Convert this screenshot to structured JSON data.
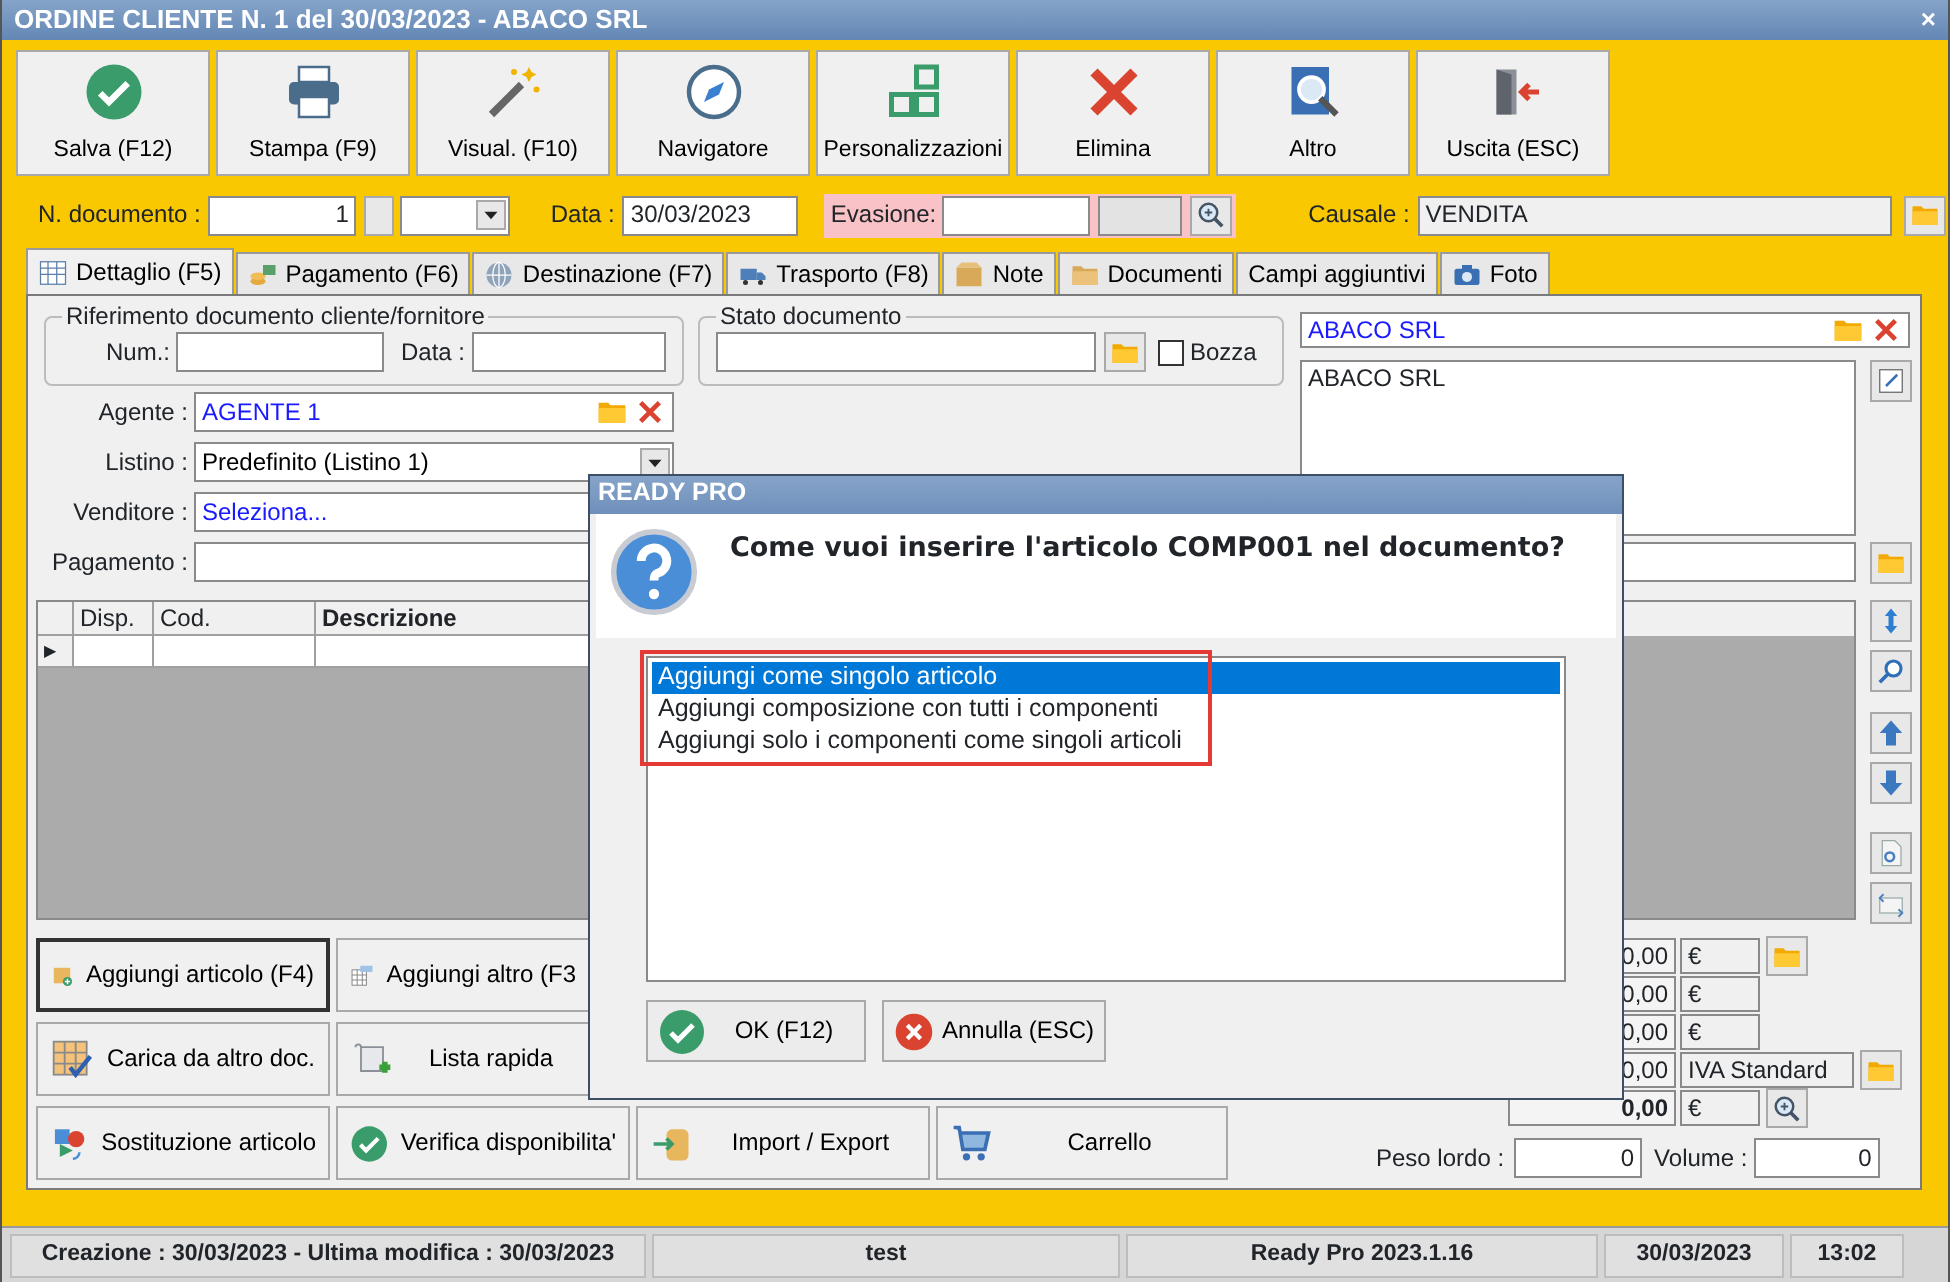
{
  "window": {
    "title": "ORDINE CLIENTE N. 1 del 30/03/2023 - ABACO SRL",
    "close": "×"
  },
  "toolbar": [
    {
      "label": "Salva (F12)",
      "kind": "check"
    },
    {
      "label": "Stampa (F9)",
      "kind": "print"
    },
    {
      "label": "Visual. (F10)",
      "kind": "wand"
    },
    {
      "label": "Navigatore",
      "kind": "compass"
    },
    {
      "label": "Personalizzazioni",
      "kind": "squares"
    },
    {
      "label": "Elimina",
      "kind": "cross"
    },
    {
      "label": "Altro",
      "kind": "magnifier"
    },
    {
      "label": "Uscita (ESC)",
      "kind": "door"
    }
  ],
  "header": {
    "n_documento": {
      "label": "N. documento :",
      "value": "1"
    },
    "data": {
      "label": "Data :",
      "value": "30/03/2023"
    },
    "evasione": {
      "label": "Evasione:"
    },
    "causale": {
      "label": "Causale :",
      "value": "VENDITA"
    }
  },
  "tabs": [
    {
      "label": "Dettaglio (F5)",
      "selected": true,
      "kind": "table"
    },
    {
      "label": "Pagamento (F6)",
      "selected": false,
      "kind": "coins"
    },
    {
      "label": "Destinazione (F7)",
      "selected": false,
      "kind": "globe"
    },
    {
      "label": "Trasporto (F8)",
      "selected": false,
      "kind": "truck"
    },
    {
      "label": "Note",
      "selected": false,
      "kind": "box"
    },
    {
      "label": "Documenti",
      "selected": false,
      "kind": "folder"
    },
    {
      "label": "Campi aggiuntivi",
      "selected": false,
      "kind": "plain"
    },
    {
      "label": "Foto",
      "selected": false,
      "kind": "camera"
    }
  ],
  "riferimento": {
    "title": "Riferimento documento cliente/fornitore",
    "num_label": "Num.:",
    "data_label": "Data :"
  },
  "stato": {
    "title": "Stato documento",
    "bozza": {
      "label": "Bozza",
      "checked": false
    }
  },
  "fields": [
    {
      "label": "Agente :",
      "value": "AGENTE 1",
      "kind": "lookup"
    },
    {
      "label": "Listino :",
      "value": "Predefinito (Listino 1)",
      "kind": "dropdown"
    },
    {
      "label": "Venditore :",
      "value": "Seleziona...",
      "kind": "link"
    },
    {
      "label": "Pagamento :",
      "kind": "plain"
    }
  ],
  "cliente": {
    "name": "ABACO SRL",
    "address": "ABACO SRL"
  },
  "grid": {
    "columns": [
      "Disp.",
      "Cod.",
      "Descrizione"
    ],
    "pointer": "▶"
  },
  "actions": [
    [
      {
        "label": "Aggiungi articolo (F4)",
        "kind": "box-add",
        "focused": true
      },
      {
        "label": "Aggiungi altro (F3",
        "kind": "table-add",
        "focused": false
      }
    ],
    [
      {
        "label": "Carica da altro doc.",
        "kind": "table-check",
        "focused": false
      },
      {
        "label": "Lista rapida",
        "kind": "scroll-add",
        "focused": false
      }
    ],
    [
      {
        "label": "Sostituzione articolo",
        "kind": "swap",
        "focused": false
      },
      {
        "label": "Verifica disponibilita'",
        "kind": "check",
        "focused": false
      },
      {
        "label": "Import / Export",
        "kind": "import",
        "focused": false
      },
      {
        "label": "Carrello",
        "kind": "cart",
        "focused": false
      }
    ]
  ],
  "totals": [
    {
      "value": "0,00",
      "unit": "€",
      "kind": "folder"
    },
    {
      "value": "0,00",
      "unit": "€",
      "kind": "plain"
    },
    {
      "value": "0,00",
      "unit": "€",
      "kind": "plain"
    },
    {
      "value": "0,00",
      "unit": "IVA Standard",
      "kind": "vat"
    },
    {
      "value": "0,00",
      "unit": "€",
      "kind": "total"
    }
  ],
  "peso": {
    "label": "Peso lordo :",
    "value": "0"
  },
  "volume": {
    "label": "Volume :",
    "value": "0"
  },
  "status_bar": [
    "Creazione : 30/03/2023 - Ultima modifica : 30/03/2023",
    "test",
    "Ready Pro 2023.1.16",
    "30/03/2023",
    "13:02"
  ],
  "dialog": {
    "title": "READY PRO",
    "question": "Come vuoi inserire l'articolo COMP001 nel documento?",
    "options": [
      {
        "label": "Aggiungi come singolo articolo",
        "selected": true
      },
      {
        "label": "Aggiungi composizione con tutti i componenti",
        "selected": false
      },
      {
        "label": "Aggiungi solo i componenti come singoli articoli",
        "selected": false
      }
    ],
    "buttons": [
      {
        "label": "OK (F12)",
        "kind": "ok"
      },
      {
        "label": "Annulla (ESC)",
        "kind": "cancel"
      }
    ]
  }
}
